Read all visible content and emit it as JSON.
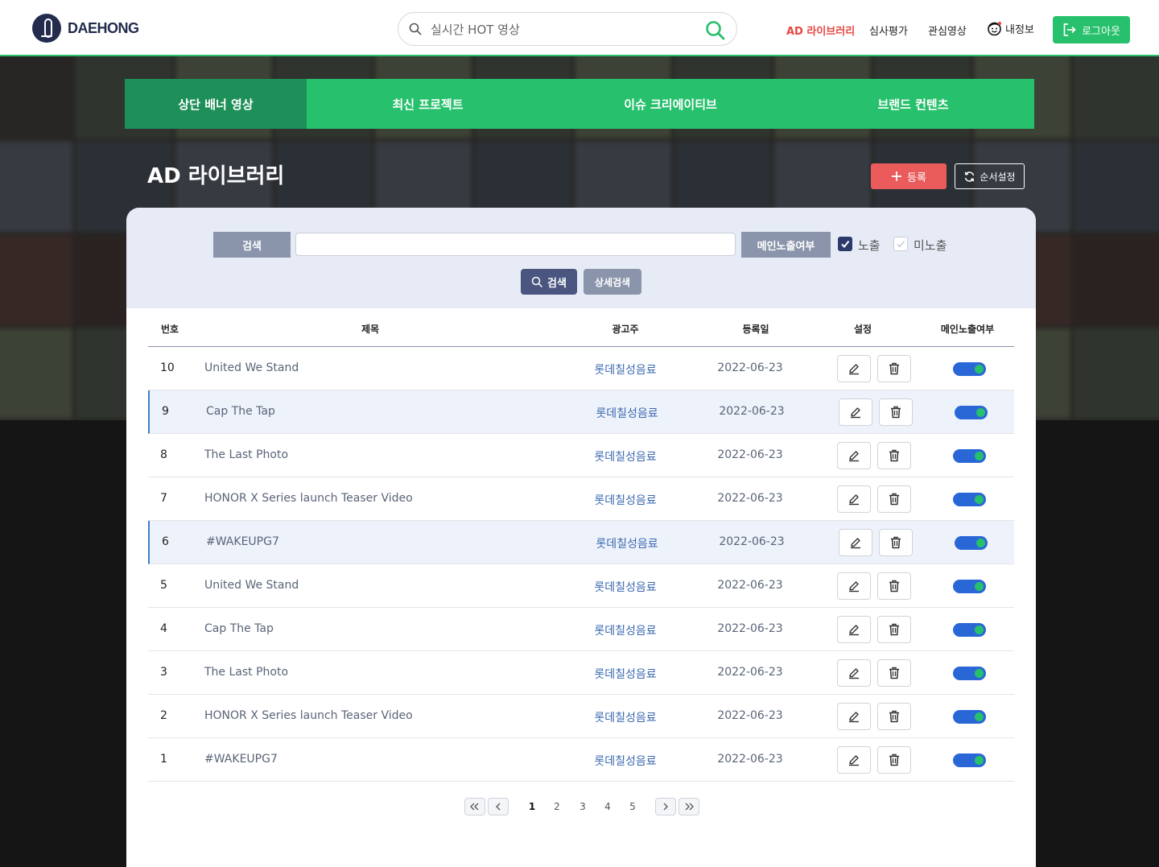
{
  "header": {
    "logo_text": "DAEHONG",
    "search_placeholder": "실시간 HOT 영상",
    "nav": [
      "AD 라이브러리",
      "심사평가",
      "관심영상",
      "내정보"
    ],
    "logout_label": "로그아웃"
  },
  "tabs": [
    "상단 배너 영상",
    "최신 프로젝트",
    "이슈 크리에이티브",
    "브랜드 컨텐츠"
  ],
  "page": {
    "title": "AD 라이브러리",
    "register_label": "등록",
    "order_label": "순서설정"
  },
  "filter": {
    "keyword_label": "검색",
    "keyword_value": "",
    "exposure_label": "메인노출여부",
    "exposed_label": "노출",
    "exposed_checked": true,
    "hidden_label": "미노출",
    "hidden_checked": false,
    "search_btn": "검색",
    "detail_btn": "상세검색"
  },
  "table": {
    "headers": [
      "번호",
      "제목",
      "광고주",
      "등록일",
      "설정",
      "메인노출여부"
    ],
    "rows": [
      {
        "no": "10",
        "title": "United We Stand",
        "advertiser": "롯데칠성음료",
        "date": "2022-06-23",
        "exposed": true
      },
      {
        "no": "9",
        "title": "Cap The Tap",
        "advertiser": "롯데칠성음료",
        "date": "2022-06-23",
        "exposed": true
      },
      {
        "no": "8",
        "title": "The Last Photo",
        "advertiser": "롯데칠성음료",
        "date": "2022-06-23",
        "exposed": true
      },
      {
        "no": "7",
        "title": "HONOR X Series launch Teaser Video",
        "advertiser": "롯데칠성음료",
        "date": "2022-06-23",
        "exposed": true
      },
      {
        "no": "6",
        "title": "#WAKEUPG7",
        "advertiser": "롯데칠성음료",
        "date": "2022-06-23",
        "exposed": true
      },
      {
        "no": "5",
        "title": "United We Stand",
        "advertiser": "롯데칠성음료",
        "date": "2022-06-23",
        "exposed": true
      },
      {
        "no": "4",
        "title": "Cap The Tap",
        "advertiser": "롯데칠성음료",
        "date": "2022-06-23",
        "exposed": true
      },
      {
        "no": "3",
        "title": "The Last Photo",
        "advertiser": "롯데칠성음료",
        "date": "2022-06-23",
        "exposed": true
      },
      {
        "no": "2",
        "title": "HONOR X Series launch Teaser Video",
        "advertiser": "롯데칠성음료",
        "date": "2022-06-23",
        "exposed": true
      },
      {
        "no": "1",
        "title": "#WAKEUPG7",
        "advertiser": "롯데칠성음료",
        "date": "2022-06-23",
        "exposed": true
      }
    ]
  },
  "pagination": {
    "pages": [
      "1",
      "2",
      "3",
      "4",
      "5"
    ],
    "current": "1"
  },
  "colors": {
    "brand_green": "#27c06c",
    "active_tab": "#1f8f5a",
    "register_red": "#ea5b5b",
    "toggle_blue": "#2a67d6",
    "navy": "#2c3a6b"
  }
}
